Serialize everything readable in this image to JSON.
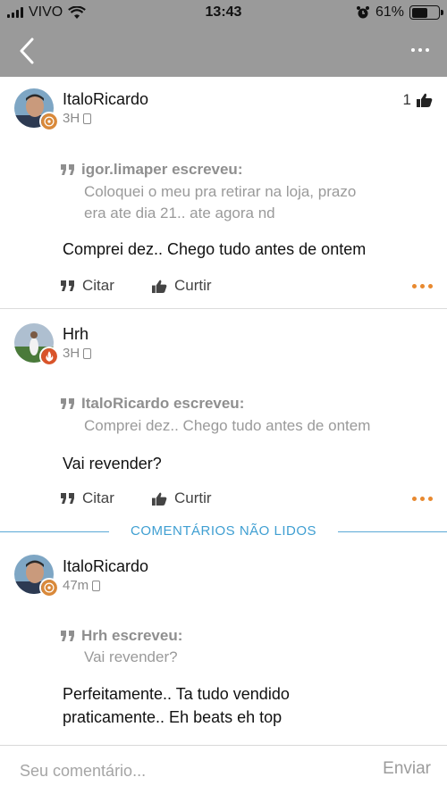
{
  "status": {
    "carrier": "VIVO",
    "time": "13:43",
    "battery": "61%",
    "battery_level": 0.61
  },
  "nav": {
    "back_icon": "chevron-left-icon",
    "more_icon": "ellipsis-icon"
  },
  "posts": [
    {
      "author": "ItaloRicardo",
      "time": "3H",
      "likes": "1",
      "quote_author": "igor.limaper escreveu:",
      "quote_lines": [
        "Coloquei o meu pra retirar na loja, prazo",
        "era ate dia 21.. ate agora nd"
      ],
      "body_lines": [
        "Comprei dez.. Chego tudo antes de ontem"
      ],
      "actions": {
        "quote": "Citar",
        "like": "Curtir"
      }
    },
    {
      "author": "Hrh",
      "time": "3H",
      "quote_author": "ItaloRicardo escreveu:",
      "quote_lines": [
        "Comprei dez.. Chego tudo antes de ontem"
      ],
      "body_lines": [
        "Vai revender?"
      ],
      "actions": {
        "quote": "Citar",
        "like": "Curtir"
      }
    },
    {
      "author": "ItaloRicardo",
      "time": "47m",
      "quote_author": "Hrh escreveu:",
      "quote_lines": [
        "Vai revender?"
      ],
      "body_lines": [
        "Perfeitamente.. Ta tudo vendido",
        "praticamente.. Eh beats eh top"
      ]
    }
  ],
  "unread_label": "COMENTÁRIOS NÃO LIDOS",
  "composer": {
    "placeholder": "Seu comentário...",
    "send_label": "Enviar"
  },
  "colors": {
    "accent_orange": "#e8892f",
    "unread_blue": "#3f9fd2",
    "header_gray": "#9a9a9a"
  }
}
